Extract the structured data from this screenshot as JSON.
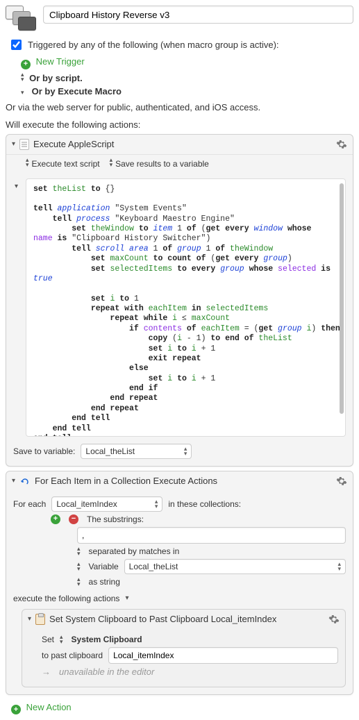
{
  "title": "Clipboard History Reverse v3",
  "triggered_label": "Triggered by any of the following (when macro group is active):",
  "new_trigger": "New Trigger",
  "triggers": {
    "script": "Or by script.",
    "execute_macro": "Or by Execute Macro",
    "web": "Or via the web server for public, authenticated, and iOS access."
  },
  "will_execute_label": "Will execute the following actions:",
  "action1": {
    "title": "Execute AppleScript",
    "opt_script": "Execute text script",
    "opt_results": "Save results to a variable",
    "code_html": "<span class=\"kw\">set</span> <span class=\"var-g\">theList</span> <span class=\"kw\">to</span> {}\n\n<span class=\"kw\">tell</span> <span class=\"class-b\">application</span> \"System Events\"\n    <span class=\"kw\">tell</span> <span class=\"class-b\">process</span> \"Keyboard Maestro Engine\"\n        <span class=\"kw\">set</span> <span class=\"var-g\">theWindow</span> <span class=\"kw\">to</span> <span class=\"class-b\">item</span> 1 <span class=\"kw\">of</span> (<span class=\"kw\">get every</span> <span class=\"class-b\">window</span> <span class=\"kw\">whose</span>\n<span class=\"purple\">name</span> <span class=\"kw\">is</span> \"Clipboard History Switcher\")\n        <span class=\"kw\">tell</span> <span class=\"class-b\">scroll area</span> 1 <span class=\"kw\">of</span> <span class=\"class-b\">group</span> 1 <span class=\"kw\">of</span> <span class=\"var-g\">theWindow</span>\n            <span class=\"kw\">set</span> <span class=\"var-g\">maxCount</span> <span class=\"kw\">to</span> <span class=\"kw\">count of</span> (<span class=\"kw\">get every</span> <span class=\"class-b\">group</span>)\n            <span class=\"kw\">set</span> <span class=\"var-g\">selectedItems</span> <span class=\"kw\">to every</span> <span class=\"class-b\">group</span> <span class=\"kw\">whose</span> <span class=\"purple\">selected</span> <span class=\"kw\">is</span>\n<span class=\"class-b\">true</span>\n\n            <span class=\"kw\">set</span> <span class=\"var-g\">i</span> <span class=\"kw\">to</span> 1\n            <span class=\"kw\">repeat with</span> <span class=\"var-g\">eachItem</span> <span class=\"kw\">in</span> <span class=\"var-g\">selectedItems</span>\n                <span class=\"kw\">repeat while</span> <span class=\"var-g\">i</span> ≤ <span class=\"var-g\">maxCount</span>\n                    <span class=\"kw\">if</span> <span class=\"purple\">contents</span> <span class=\"kw\">of</span> <span class=\"var-g\">eachItem</span> = (<span class=\"kw\">get</span> <span class=\"class-b\">group</span> <span class=\"var-g\">i</span>) <span class=\"kw\">then</span>\n                        <span class=\"kw\">copy</span> (<span class=\"var-g\">i</span> - 1) <span class=\"kw\">to end of</span> <span class=\"var-g\">theList</span>\n                        <span class=\"kw\">set</span> <span class=\"var-g\">i</span> <span class=\"kw\">to</span> <span class=\"var-g\">i</span> + 1\n                        <span class=\"kw\">exit repeat</span>\n                    <span class=\"kw\">else</span>\n                        <span class=\"kw\">set</span> <span class=\"var-g\">i</span> <span class=\"kw\">to</span> <span class=\"var-g\">i</span> + 1\n                    <span class=\"kw\">end if</span>\n                <span class=\"kw\">end repeat</span>\n            <span class=\"kw\">end repeat</span>\n        <span class=\"kw\">end tell</span>\n    <span class=\"kw\">end tell</span>\n<span class=\"kw\">end tell</span>",
    "save_label": "Save to variable:",
    "save_var": "Local_theList"
  },
  "action2": {
    "title": "For Each Item in a Collection Execute Actions",
    "foreach_label": "For each",
    "foreach_var": "Local_itemIndex",
    "in_collections": "in these collections:",
    "substrings_label": "The substrings:",
    "delimiter": ",",
    "sep_label": "separated by matches in",
    "var_kw": "Variable",
    "var_value": "Local_theList",
    "as_string": "as string",
    "exec_label": "execute the following actions",
    "inner": {
      "title": "Set System Clipboard to Past Clipboard Local_itemIndex",
      "set_label": "Set",
      "clipboard_type": "System Clipboard",
      "to_past_label": "to past clipboard",
      "to_past_value": "Local_itemIndex",
      "note": "unavailable in the editor"
    }
  },
  "new_action": "New Action"
}
